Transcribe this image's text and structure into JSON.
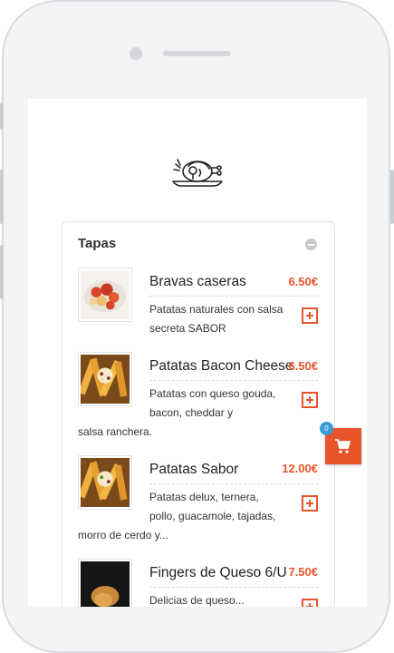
{
  "section": {
    "title": "Tapas",
    "items": [
      {
        "name": "Bravas caseras",
        "price": "6.50€",
        "desc_lines": [
          "Patatas naturales con salsa",
          "secreta SABOR"
        ]
      },
      {
        "name": "Patatas Bacon Cheese",
        "price": "6.50€",
        "desc_lines": [
          "Patatas con queso gouda,",
          "bacon, cheddar y",
          "salsa ranchera."
        ]
      },
      {
        "name": "Patatas Sabor",
        "price": "12.00€",
        "desc_lines": [
          "Patatas delux, ternera,",
          "pollo, guacamole, tajadas,",
          "morro de cerdo y..."
        ]
      },
      {
        "name": "Fingers de Queso 6/U",
        "price": "7.50€",
        "desc_lines": [
          "Delicias de queso..."
        ]
      }
    ]
  },
  "cart": {
    "count": "0"
  },
  "colors": {
    "accent": "#e8552a",
    "badge": "#3a9ad9"
  },
  "icons": [
    "restaurant-logo-icon",
    "collapse-icon",
    "add-icon",
    "cart-icon"
  ]
}
